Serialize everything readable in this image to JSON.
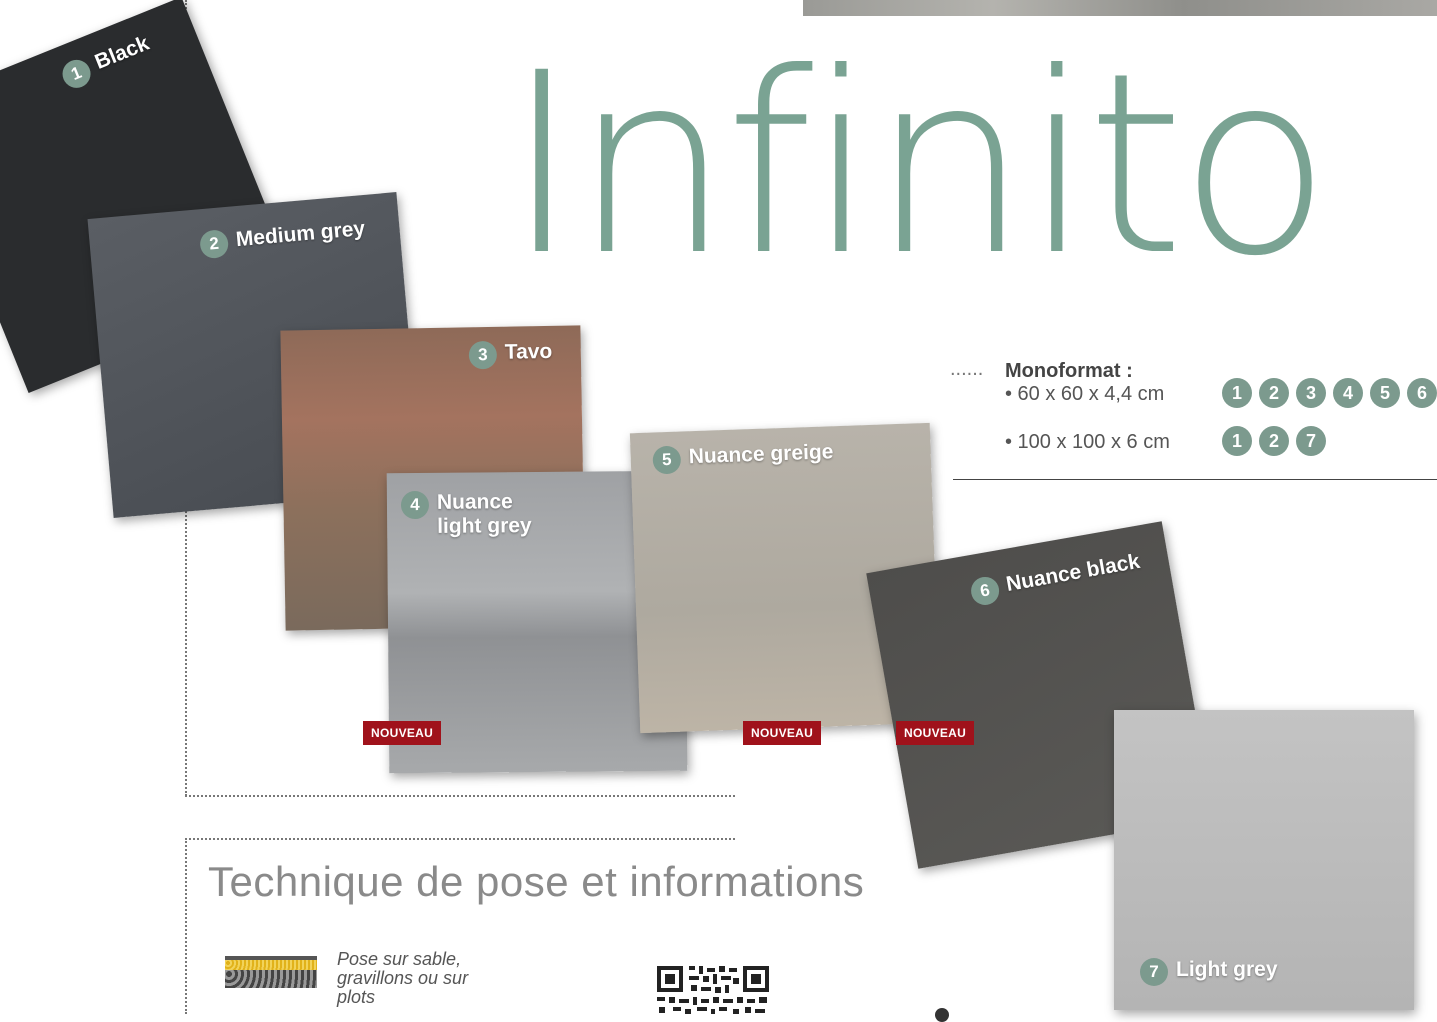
{
  "title": "Infinito",
  "tiles": [
    {
      "num": "1",
      "label": "Black",
      "color": "#2a2c2e"
    },
    {
      "num": "2",
      "label": "Medium grey",
      "color": "#50545a"
    },
    {
      "num": "3",
      "label": "Tavo",
      "color": "#8c6a57"
    },
    {
      "num": "4",
      "label": "Nuance light grey",
      "label_line1": "Nuance",
      "label_line2": "light grey",
      "color": "#a3a5a7",
      "badge": "NOUVEAU"
    },
    {
      "num": "5",
      "label": "Nuance greige",
      "color": "#b4afa6",
      "badge": "NOUVEAU"
    },
    {
      "num": "6",
      "label": "Nuance black",
      "color": "#545350",
      "badge": "NOUVEAU"
    },
    {
      "num": "7",
      "label": "Light grey",
      "color": "#b9b9b9"
    }
  ],
  "specs": {
    "leader": "......",
    "heading": "Monoformat :",
    "rows": [
      {
        "text": "• 60 x 60 x 4,4 cm",
        "colors": [
          "1",
          "2",
          "3",
          "4",
          "5",
          "6"
        ]
      },
      {
        "text": "• 100 x 100 x 6 cm",
        "colors": [
          "1",
          "2",
          "7"
        ]
      }
    ]
  },
  "technique": {
    "title": "Technique de pose et informations",
    "pose_text": "Pose sur sable, gravillons ou sur plots"
  },
  "colors": {
    "accent": "#7c9a8e",
    "title": "#7aa393",
    "badge": "#a0121b"
  }
}
